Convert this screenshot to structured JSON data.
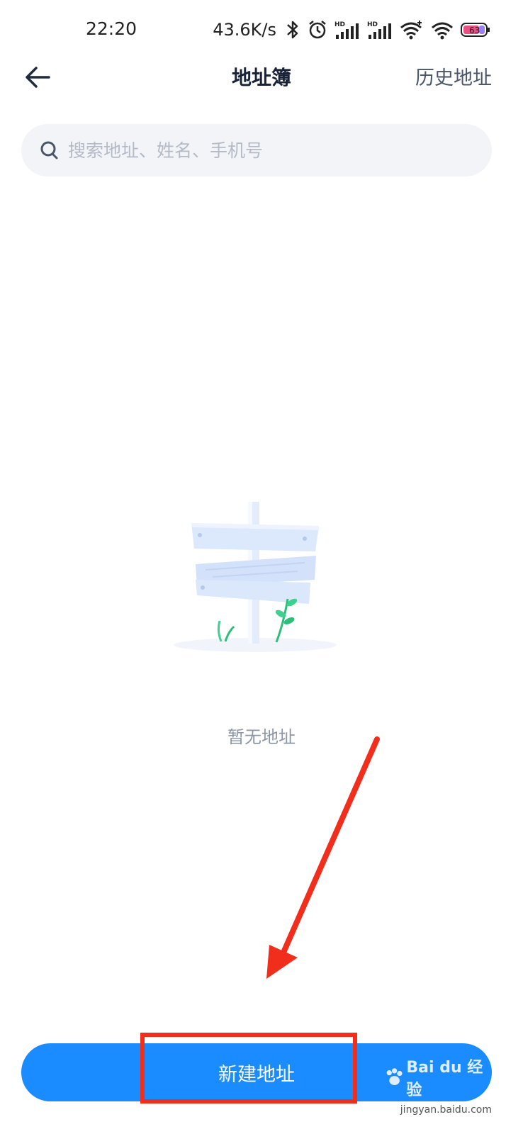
{
  "status_bar": {
    "time": "22:20",
    "net_speed": "43.6K/s",
    "battery_level": "63",
    "icons": [
      "bluetooth-icon",
      "alarm-icon",
      "hd-signal-icon",
      "hd-signal-icon",
      "wifi-plus-icon",
      "wifi-icon",
      "battery-icon"
    ]
  },
  "header": {
    "title": "地址簿",
    "history_label": "历史地址",
    "back_icon": "arrow-left-icon"
  },
  "search": {
    "placeholder": "搜索地址、姓名、手机号",
    "value": "",
    "icon": "search-icon"
  },
  "empty_state": {
    "illustration": "signpost-illustration",
    "message": "暂无地址"
  },
  "footer": {
    "new_address_label": "新建地址"
  },
  "watermark": {
    "brand": "Bai du 经验",
    "url": "jingyan.baidu.com"
  },
  "colors": {
    "accent": "#1a8cff",
    "annotation": "#f12d1b",
    "search_bg": "#f2f4f8"
  }
}
